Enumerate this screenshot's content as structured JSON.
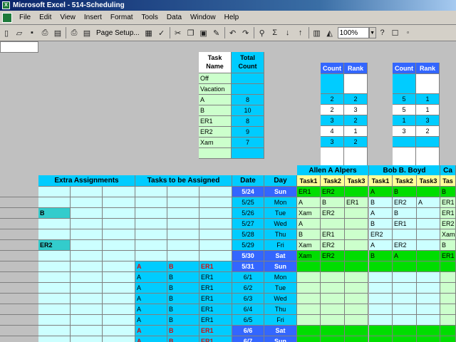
{
  "window": {
    "title": "Microsoft Excel - 514-Scheduling"
  },
  "menu": [
    "File",
    "Edit",
    "View",
    "Insert",
    "Format",
    "Tools",
    "Data",
    "Window",
    "Help"
  ],
  "toolbar": {
    "page_setup": "Page Setup...",
    "zoom": "100%"
  },
  "summary_table": {
    "col_task_name": "Task Name",
    "col_total_count": "Total Count",
    "rows": [
      {
        "name": "Off",
        "count": ""
      },
      {
        "name": "Vacation",
        "count": ""
      },
      {
        "name": "A",
        "count": "8"
      },
      {
        "name": "B",
        "count": "10"
      },
      {
        "name": "ER1",
        "count": "8"
      },
      {
        "name": "ER2",
        "count": "9"
      },
      {
        "name": "Xam",
        "count": "7"
      }
    ]
  },
  "count_rank_1": {
    "count": "Count",
    "rank": "Rank",
    "rows": [
      [
        "",
        ""
      ],
      [
        "2",
        "2"
      ],
      [
        "2",
        "3"
      ],
      [
        "3",
        "2"
      ],
      [
        "4",
        "1"
      ],
      [
        "3",
        "2"
      ],
      [
        "",
        ""
      ]
    ]
  },
  "count_rank_2": {
    "count": "Count",
    "rank": "Rank",
    "rows": [
      [
        "",
        ""
      ],
      [
        "5",
        "1"
      ],
      [
        "5",
        "1"
      ],
      [
        "1",
        "3"
      ],
      [
        "3",
        "2"
      ],
      [
        "",
        ""
      ],
      [
        "",
        ""
      ]
    ]
  },
  "headers": {
    "extra_assignments": "Extra Assignments",
    "tasks_to_assign": "Tasks to be Assigned",
    "date": "Date",
    "day": "Day",
    "person1": "Allen A Alpers",
    "person2": "Bob B. Boyd",
    "person3": "Ca",
    "task1": "Task1",
    "task2": "Task2",
    "task3": "Task3",
    "task_partial": "Tas"
  },
  "schedule": [
    {
      "extra": "",
      "assign": [
        "",
        "",
        ""
      ],
      "date": "5/24",
      "day": "Sun",
      "p1": [
        "ER1",
        "ER2",
        ""
      ],
      "p2": [
        "A",
        "B",
        ""
      ],
      "p3": "B"
    },
    {
      "extra": "",
      "assign": [
        "",
        "",
        ""
      ],
      "date": "5/25",
      "day": "Mon",
      "p1": [
        "A",
        "B",
        "ER1"
      ],
      "p2": [
        "B",
        "ER2",
        "A"
      ],
      "p3": "ER1"
    },
    {
      "extra": "B",
      "assign": [
        "",
        "",
        ""
      ],
      "date": "5/26",
      "day": "Tue",
      "p1": [
        "Xam",
        "ER2",
        ""
      ],
      "p2": [
        "A",
        "B",
        ""
      ],
      "p3": "ER1"
    },
    {
      "extra": "",
      "assign": [
        "",
        "",
        ""
      ],
      "date": "5/27",
      "day": "Wed",
      "p1": [
        "A",
        "",
        ""
      ],
      "p2": [
        "B",
        "ER1",
        ""
      ],
      "p3": "ER2"
    },
    {
      "extra": "",
      "assign": [
        "",
        "",
        ""
      ],
      "date": "5/28",
      "day": "Thu",
      "p1": [
        "B",
        "ER1",
        ""
      ],
      "p2": [
        "ER2",
        "",
        ""
      ],
      "p3": "Xam"
    },
    {
      "extra": "ER2",
      "assign": [
        "",
        "",
        ""
      ],
      "date": "5/29",
      "day": "Fri",
      "p1": [
        "Xam",
        "ER2",
        ""
      ],
      "p2": [
        "A",
        "ER2",
        ""
      ],
      "p3": "B"
    },
    {
      "extra": "",
      "assign": [
        "",
        "",
        ""
      ],
      "date": "5/30",
      "day": "Sat",
      "p1": [
        "Xam",
        "ER2",
        ""
      ],
      "p2": [
        "B",
        "A",
        ""
      ],
      "p3": "ER1"
    },
    {
      "extra": "",
      "assign": [
        "A",
        "B",
        "ER1"
      ],
      "date": "5/31",
      "day": "Sun",
      "p1": [
        "",
        "",
        ""
      ],
      "p2": [
        "",
        "",
        ""
      ],
      "p3": ""
    },
    {
      "extra": "",
      "assign": [
        "A",
        "B",
        "ER1"
      ],
      "date": "6/1",
      "day": "Mon",
      "p1": [
        "",
        "",
        ""
      ],
      "p2": [
        "",
        "",
        ""
      ],
      "p3": ""
    },
    {
      "extra": "",
      "assign": [
        "A",
        "B",
        "ER1"
      ],
      "date": "6/2",
      "day": "Tue",
      "p1": [
        "",
        "",
        ""
      ],
      "p2": [
        "",
        "",
        ""
      ],
      "p3": ""
    },
    {
      "extra": "",
      "assign": [
        "A",
        "B",
        "ER1"
      ],
      "date": "6/3",
      "day": "Wed",
      "p1": [
        "",
        "",
        ""
      ],
      "p2": [
        "",
        "",
        ""
      ],
      "p3": ""
    },
    {
      "extra": "",
      "assign": [
        "A",
        "B",
        "ER1"
      ],
      "date": "6/4",
      "day": "Thu",
      "p1": [
        "",
        "",
        ""
      ],
      "p2": [
        "",
        "",
        ""
      ],
      "p3": ""
    },
    {
      "extra": "",
      "assign": [
        "A",
        "B",
        "ER1"
      ],
      "date": "6/5",
      "day": "Fri",
      "p1": [
        "",
        "",
        ""
      ],
      "p2": [
        "",
        "",
        ""
      ],
      "p3": ""
    },
    {
      "extra": "",
      "assign": [
        "A",
        "B",
        "ER1"
      ],
      "date": "6/6",
      "day": "Sat",
      "p1": [
        "",
        "",
        ""
      ],
      "p2": [
        "",
        "",
        ""
      ],
      "p3": ""
    },
    {
      "extra": "",
      "assign": [
        "A",
        "B",
        "ER1"
      ],
      "date": "6/7",
      "day": "Sun",
      "p1": [
        "",
        "",
        ""
      ],
      "p2": [
        "",
        "",
        ""
      ],
      "p3": ""
    }
  ]
}
